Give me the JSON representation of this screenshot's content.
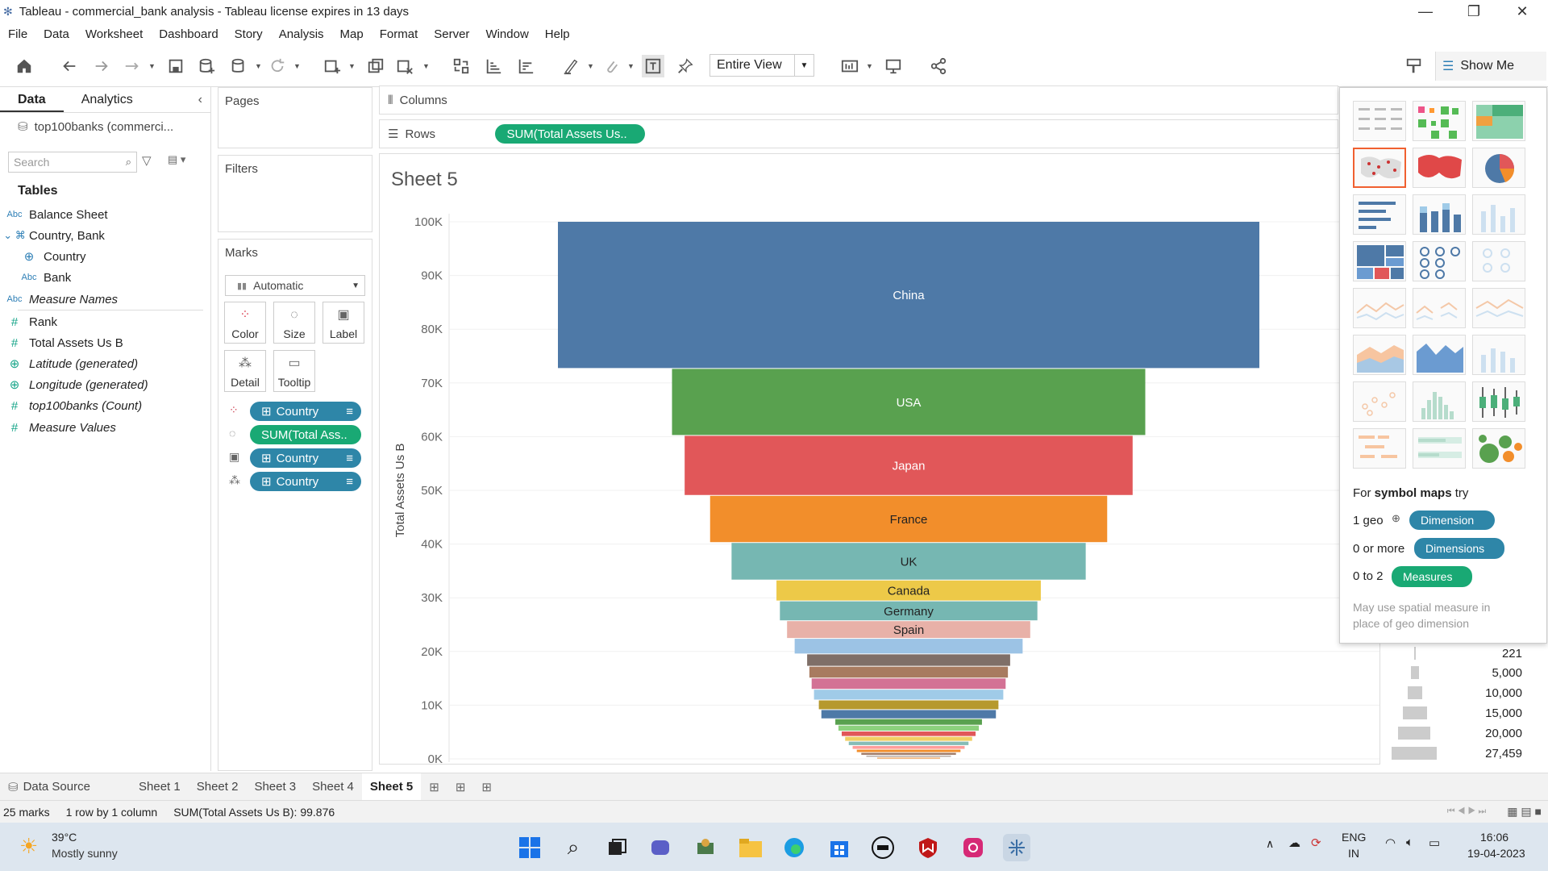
{
  "window": {
    "title": "Tableau - commercial_bank analysis - Tableau license expires in 13 days"
  },
  "menu": [
    "File",
    "Data",
    "Worksheet",
    "Dashboard",
    "Story",
    "Analysis",
    "Map",
    "Format",
    "Server",
    "Window",
    "Help"
  ],
  "toolbar": {
    "view_select": "Entire View",
    "show_me": "Show Me"
  },
  "data_pane": {
    "tab_data": "Data",
    "tab_analytics": "Analytics",
    "datasource": "top100banks (commerci...",
    "search_placeholder": "Search",
    "tables_heading": "Tables",
    "fields": [
      {
        "type": "Abc",
        "label": "Balance Sheet"
      },
      {
        "type": "hier",
        "label": "Country, Bank"
      },
      {
        "type": "geo",
        "label": "Country"
      },
      {
        "type": "Abc",
        "label": "Bank"
      },
      {
        "type": "Abc",
        "label": "Measure Names"
      },
      {
        "type": "#",
        "label": "Rank"
      },
      {
        "type": "#",
        "label": "Total Assets Us B"
      },
      {
        "type": "geo",
        "label": "Latitude (generated)"
      },
      {
        "type": "geo",
        "label": "Longitude (generated)"
      },
      {
        "type": "#",
        "label": "top100banks (Count)"
      },
      {
        "type": "#",
        "label": "Measure Values"
      }
    ]
  },
  "shelves": {
    "pages": "Pages",
    "filters": "Filters",
    "marks": "Marks",
    "mark_type": "Automatic",
    "mark_buttons": [
      "Color",
      "Size",
      "Label",
      "Detail",
      "Tooltip"
    ],
    "mark_pills": [
      "Country",
      "SUM(Total Ass..",
      "Country",
      "Country"
    ],
    "columns": "Columns",
    "rows": "Rows",
    "rows_pill": "SUM(Total Assets Us.."
  },
  "sheet": {
    "title": "Sheet 5"
  },
  "chart_data": {
    "type": "bar",
    "ylabel": "Total Assets Us B",
    "ylim": [
      0,
      100000
    ],
    "yticks": [
      "100K",
      "90K",
      "80K",
      "70K",
      "60K",
      "50K",
      "40K",
      "30K",
      "20K",
      "10K",
      "0K"
    ],
    "segments": [
      {
        "label": "China",
        "value": 27459,
        "color": "#4e79a7"
      },
      {
        "label": "USA",
        "value": 12500,
        "color": "#59a14f"
      },
      {
        "label": "Japan",
        "value": 11200,
        "color": "#e15759"
      },
      {
        "label": "France",
        "value": 8800,
        "color": "#f28e2b"
      },
      {
        "label": "UK",
        "value": 7000,
        "color": "#76b7b2"
      },
      {
        "label": "Canada",
        "value": 3900,
        "color": "#edc948"
      },
      {
        "label": "Germany",
        "value": 3700,
        "color": "#76b7b2"
      },
      {
        "label": "Spain",
        "value": 3300,
        "color": "#e8b1a8"
      },
      {
        "label": "",
        "value": 2900,
        "color": "#9cc3e5"
      },
      {
        "label": "",
        "value": 2300,
        "color": "#7f6f68"
      },
      {
        "label": "",
        "value": 2200,
        "color": "#a87b60"
      },
      {
        "label": "",
        "value": 2100,
        "color": "#d37295"
      },
      {
        "label": "",
        "value": 2000,
        "color": "#a0cbe8"
      },
      {
        "label": "",
        "value": 1800,
        "color": "#b6992d"
      },
      {
        "label": "",
        "value": 1700,
        "color": "#4e79a7"
      },
      {
        "label": "",
        "value": 1200,
        "color": "#59a14f"
      },
      {
        "label": "",
        "value": 1100,
        "color": "#8cd17d"
      },
      {
        "label": "",
        "value": 1000,
        "color": "#e15759"
      },
      {
        "label": "",
        "value": 900,
        "color": "#f1ce63"
      },
      {
        "label": "",
        "value": 800,
        "color": "#86bcb6"
      },
      {
        "label": "",
        "value": 700,
        "color": "#ff9d9a"
      },
      {
        "label": "",
        "value": 600,
        "color": "#f28e2b"
      },
      {
        "label": "",
        "value": 500,
        "color": "#9d7660"
      },
      {
        "label": "",
        "value": 400,
        "color": "#bab0ac"
      },
      {
        "label": "",
        "value": 221,
        "color": "#f28e2b"
      }
    ]
  },
  "show_me": {
    "hint_prefix": "For ",
    "hint_bold": "symbol maps",
    "hint_suffix": " try",
    "req1_label": "1 geo",
    "req1_pill": "Dimension",
    "req2_label": "0 or more",
    "req2_pill": "Dimensions",
    "req3_label": "0 to 2",
    "req3_pill": "Measures",
    "note": "May use spatial measure in place of geo dimension"
  },
  "size_legend": [
    "221",
    "5,000",
    "10,000",
    "15,000",
    "20,000",
    "27,459"
  ],
  "sheet_tabs": [
    "Data Source",
    "Sheet 1",
    "Sheet 2",
    "Sheet 3",
    "Sheet 4",
    "Sheet 5"
  ],
  "status": {
    "marks": "25 marks",
    "rows": "1 row by 1 column",
    "sum": "SUM(Total Assets Us B): 99.876"
  },
  "taskbar": {
    "temp": "39°C",
    "weather": "Mostly sunny",
    "lang1": "ENG",
    "lang2": "IN",
    "time": "16:06",
    "date": "19-04-2023"
  }
}
